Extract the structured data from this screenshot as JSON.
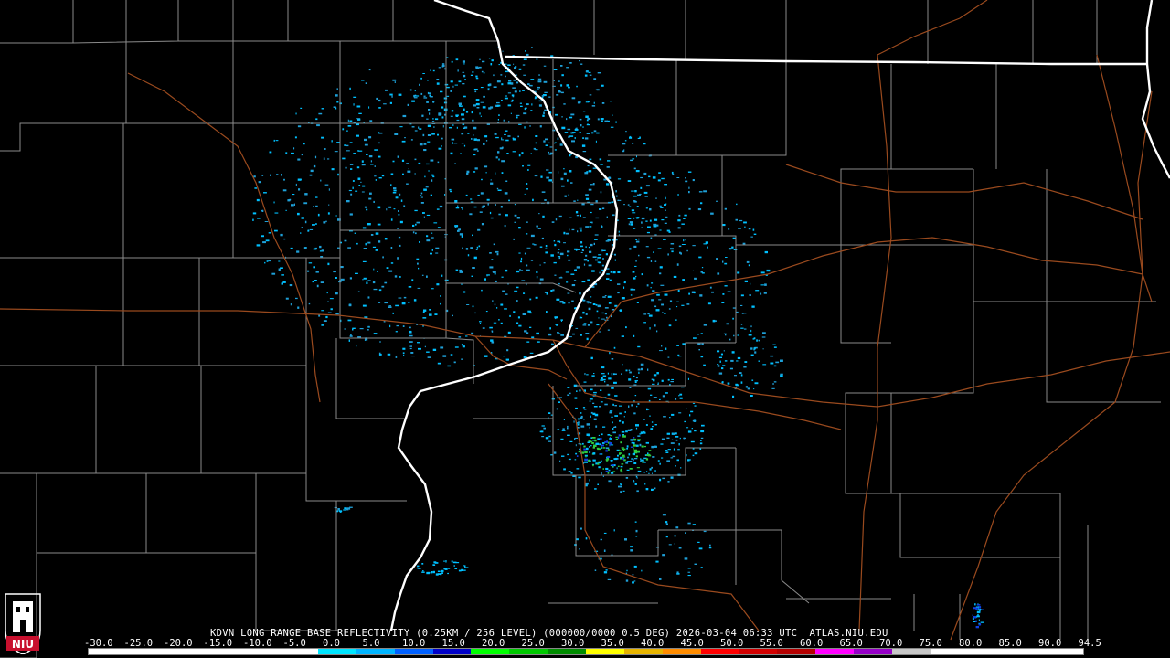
{
  "product": {
    "title": "KDVN LONG RANGE BASE REFLECTIVITY (0.25KM / 256 LEVEL) (000000/0000 0.5 DEG) 2026-03-04 06:33 UTC  ATLAS.NIU.EDU"
  },
  "legend": {
    "scale_values": [
      "-30.0",
      "-25.0",
      "-20.0",
      "-15.0",
      "-10.0",
      "-5.0",
      "0.0",
      "5.0",
      "10.0",
      "15.0",
      "20.0",
      "25.0",
      "30.0",
      "35.0",
      "40.0",
      "45.0",
      "50.0",
      "55.0",
      "60.0",
      "65.0",
      "70.0",
      "75.0",
      "80.0",
      "85.0",
      "90.0",
      "94.5"
    ],
    "colors": [
      "#ffffff",
      "#ffffff",
      "#ffffff",
      "#ffffff",
      "#ffffff",
      "#ffffff",
      "#00e5ff",
      "#00b4ff",
      "#0060ff",
      "#0000c8",
      "#00ff00",
      "#00c800",
      "#008c00",
      "#ffff00",
      "#e6b400",
      "#ff8c00",
      "#ff0000",
      "#d20000",
      "#b40000",
      "#ff00ff",
      "#9600c8",
      "#c8c8c8",
      "#ffffff",
      "#ffffff",
      "#ffffff",
      "#ffffff"
    ]
  },
  "logo": {
    "text": "NIU",
    "color": "#c8102e"
  },
  "map_colors": {
    "background": "#000000",
    "county_lines": "#8a8a8a",
    "state_lines": "#ffffff",
    "highways": "#9a4a1e",
    "echo_light": "#1ea0d8",
    "echo_medium": "#00c0ff",
    "echo_green": "#2ecc40",
    "echo_blue": "#1040e0"
  }
}
